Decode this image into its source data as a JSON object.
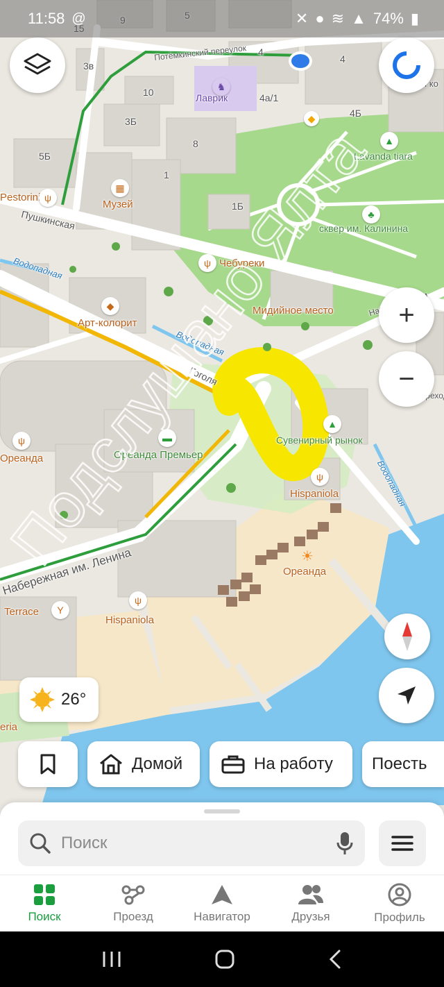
{
  "status_bar": {
    "time": "11:58",
    "battery": "74%"
  },
  "map": {
    "labels": {
      "lavrik": "Лаврик",
      "lavanda": "Lavanda tiara",
      "muzey": "Музей",
      "pestorini": "Pestorini",
      "pushkinskaya": "Пушкинская",
      "skver": "сквер им. Калинина",
      "chebureki": "Чебуреки",
      "mestnoe": "Мидийное место",
      "art_kolorit": "Арт-колорит",
      "vodopadnaya1": "Водопадная",
      "vodopadnaya2": "Водопадная",
      "vodopadnaya3": "Водопадная",
      "gogolya": "Гоголя",
      "oreanda1": "Ореанда",
      "oreanda_premier": "Ореанда Премьер",
      "suvenirny": "Сувенирный рынок",
      "hispaniola1": "Hispaniola",
      "hispaniola2": "Hispaniola",
      "oreanda_beach": "Ореанда",
      "naberezhnaya": "Набережная им. Ленина",
      "terrace": "Terrace",
      "eria": "eria",
      "potemkinsky": "Потёмкинский переулок",
      "dom_ko": "Дом ко",
      "naberezhnaya_im": "Набережная им",
      "perekhod": "Переход",
      "b_9": "9",
      "b_5": "5",
      "b_15": "15",
      "b_3v": "3в",
      "b_10": "10",
      "b_3b": "3Б",
      "b_5b": "5Б",
      "b_8": "8",
      "b_1": "1",
      "b_1b": "1Б",
      "b_4": "4",
      "b_4_2": "4",
      "b_4a1": "4а/1",
      "b_4b": "4Б"
    },
    "watermark": "Подслушано Ялта"
  },
  "controls": {
    "layers_icon": "layers-icon",
    "alice_icon": "alice-icon",
    "zoom_in": "+",
    "zoom_out": "−",
    "compass_icon": "compass-icon",
    "locate_icon": "locate-arrow-icon"
  },
  "weather": {
    "temp": "26°"
  },
  "shortcuts": {
    "home": "Домой",
    "work": "На работу",
    "eat": "Поесть"
  },
  "search": {
    "placeholder": "Поиск"
  },
  "tabs": [
    {
      "label": "Поиск",
      "active": true
    },
    {
      "label": "Проезд"
    },
    {
      "label": "Навигатор"
    },
    {
      "label": "Друзья"
    },
    {
      "label": "Профиль"
    }
  ],
  "colors": {
    "accent": "#1a9e3e",
    "water": "#7fc6ee",
    "park": "#a6d98c",
    "route": "#f2b705"
  }
}
